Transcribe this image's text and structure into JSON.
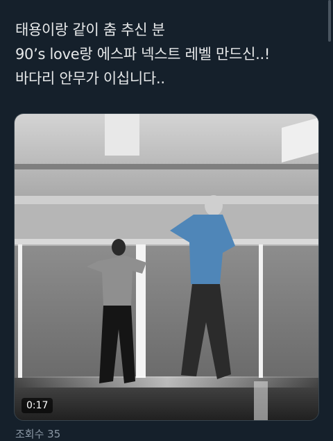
{
  "tweet": {
    "lines": [
      "태용이랑 같이 춤 추신 분",
      "90’s love랑 에스파 넥스트 레벨 만드신..!",
      "바다리 안무가 이십니다.."
    ]
  },
  "video": {
    "duration": "0:17"
  },
  "footer": {
    "views": "조회수 35"
  }
}
